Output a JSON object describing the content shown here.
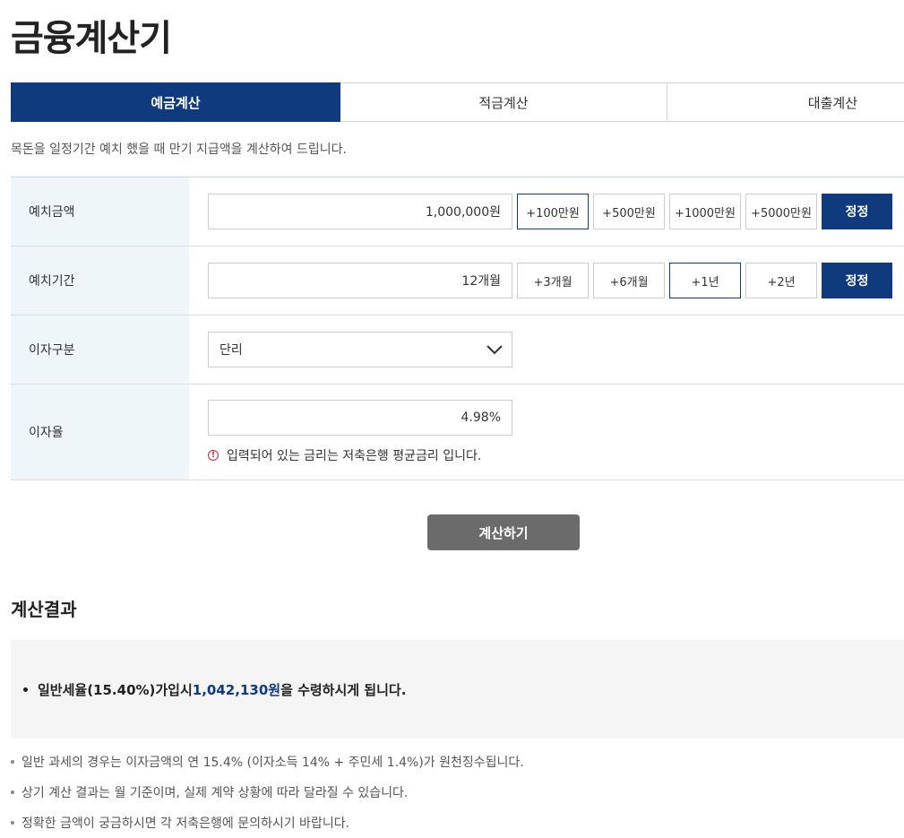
{
  "page": {
    "title": "금융계산기"
  },
  "tabs": [
    {
      "label": "예금계산",
      "active": true
    },
    {
      "label": "적금계산",
      "active": false
    },
    {
      "label": "대출계산",
      "active": false
    }
  ],
  "description": "목돈을 일정기간 예치 했을 때 만기 지급액을 계산하여 드립니다.",
  "form": {
    "deposit_amount": {
      "label": "예치금액",
      "value": "1,000,000원",
      "chips": [
        "+100만원",
        "+500만원",
        "+1000만원",
        "+5000만원"
      ],
      "selected_chip": "+100만원",
      "reset_label": "정정"
    },
    "deposit_period": {
      "label": "예치기간",
      "value": "12개월",
      "chips": [
        "+3개월",
        "+6개월",
        "+1년",
        "+2년"
      ],
      "selected_chip": "+1년",
      "reset_label": "정정"
    },
    "interest_type": {
      "label": "이자구분",
      "selected": "단리"
    },
    "interest_rate": {
      "label": "이자율",
      "value": "4.98%",
      "notice": "입력되어 있는 금리는 저축은행 평균금리 입니다."
    }
  },
  "calculate_button": "계산하기",
  "result": {
    "title": "계산결과",
    "line_prefix": "일반세율(15.40%)가입시 ",
    "amount": "1,042,130원",
    "line_suffix": "을 수령하시게 됩니다."
  },
  "notes": [
    "일반 과세의 경우는 이자금액의 연 15.4% (이자소득 14% + 주민세 1.4%)가 원천징수됩니다.",
    "상기 계산 결과는 월 기준이며, 실제 계약 상황에 따라 달라질 수 있습니다.",
    "정확한 금액이 궁금하시면 각 저축은행에 문의하시기 바랍니다."
  ],
  "colors": {
    "primary": "#0f3a7d",
    "label_bg": "#eef6f9",
    "button_gray": "#6b6b6b",
    "warning": "#c8282d"
  }
}
